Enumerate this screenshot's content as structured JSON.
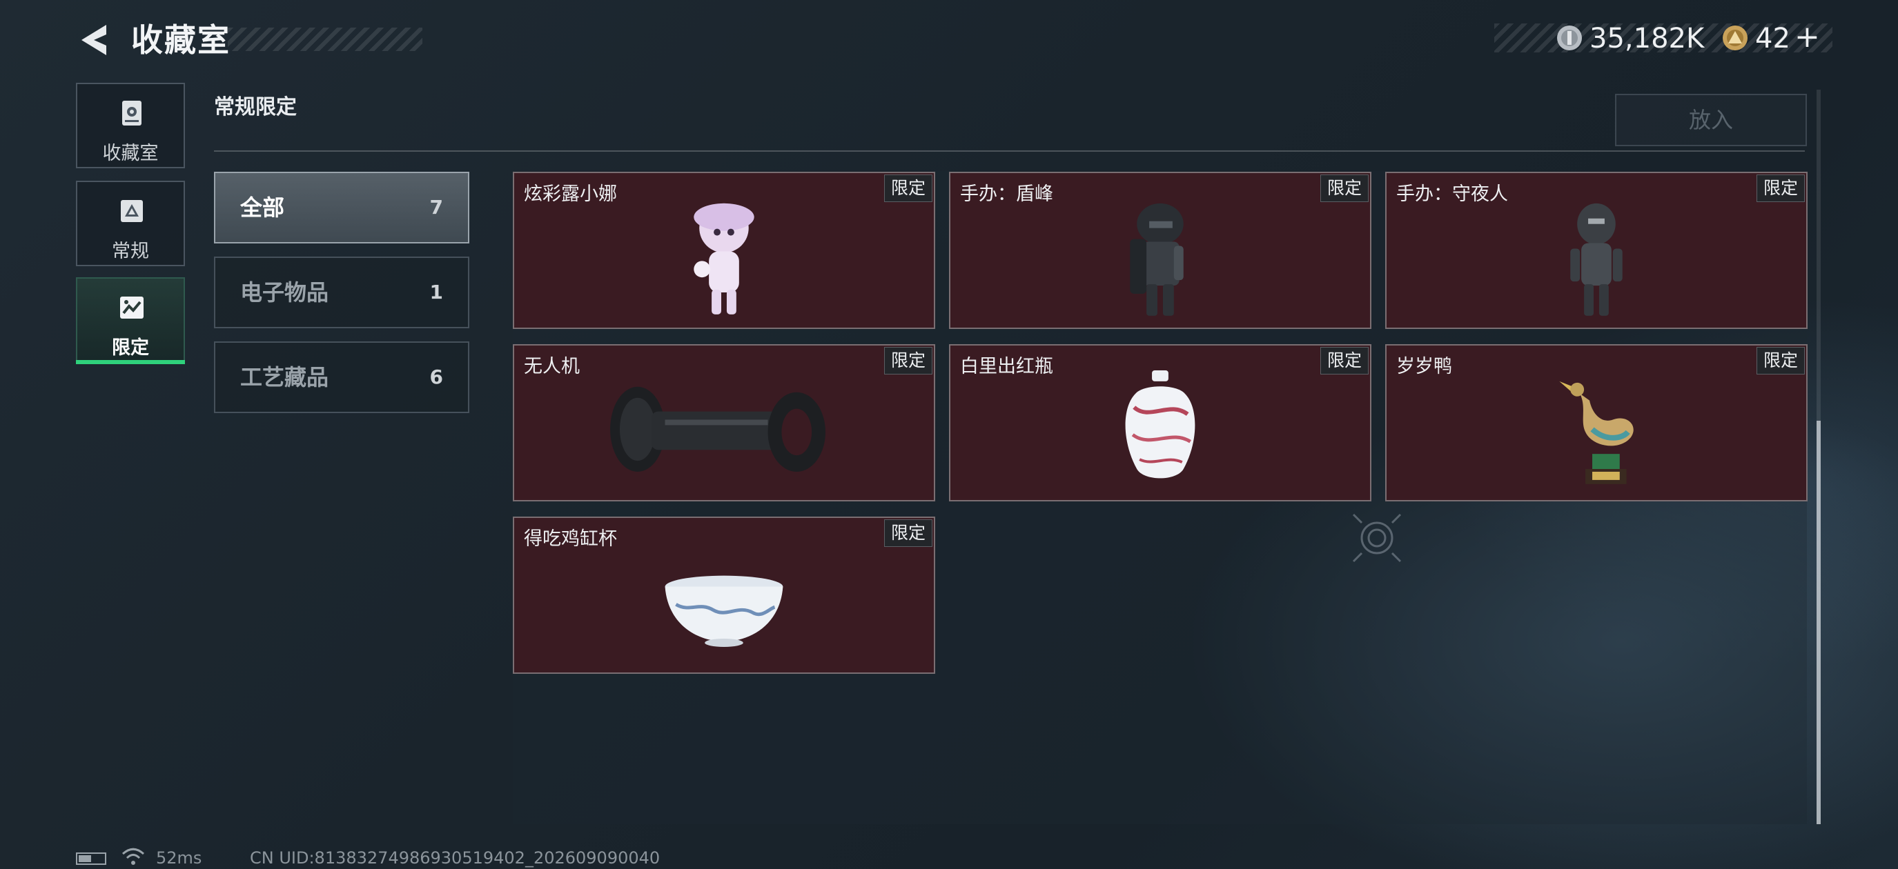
{
  "header": {
    "title": "收藏室",
    "currency1_value": "35,182K",
    "currency2_value": "42",
    "add_symbol": "+"
  },
  "nav": [
    {
      "label": "收藏室",
      "icon": "collection-room-icon",
      "active": false
    },
    {
      "label": "常规",
      "icon": "regular-icon",
      "active": false
    },
    {
      "label": "限定",
      "icon": "limited-icon",
      "active": true
    }
  ],
  "section": {
    "title": "常规限定",
    "put_button": "放入"
  },
  "categories": [
    {
      "label": "全部",
      "count": "7",
      "active": true
    },
    {
      "label": "电子物品",
      "count": "1",
      "active": false
    },
    {
      "label": "工艺藏品",
      "count": "6",
      "active": false
    }
  ],
  "items": [
    {
      "name": "炫彩露小娜",
      "badge": "限定",
      "art": "figure-lunana-icon"
    },
    {
      "name": "手办：盾峰",
      "badge": "限定",
      "art": "figure-shield-icon"
    },
    {
      "name": "手办：守夜人",
      "badge": "限定",
      "art": "figure-nightwatch-icon"
    },
    {
      "name": "无人机",
      "badge": "限定",
      "art": "drone-icon"
    },
    {
      "name": "白里出红瓶",
      "badge": "限定",
      "art": "vase-icon"
    },
    {
      "name": "岁岁鸭",
      "badge": "限定",
      "art": "duck-icon"
    },
    {
      "name": "得吃鸡缸杯",
      "badge": "限定",
      "art": "cup-icon"
    }
  ],
  "footer": {
    "ping": "52ms",
    "uid": "CN UID:8138327498693051940​2_202609090040"
  },
  "colors": {
    "card_bg": "#3a1b22",
    "active_underline": "#2fd17b"
  }
}
